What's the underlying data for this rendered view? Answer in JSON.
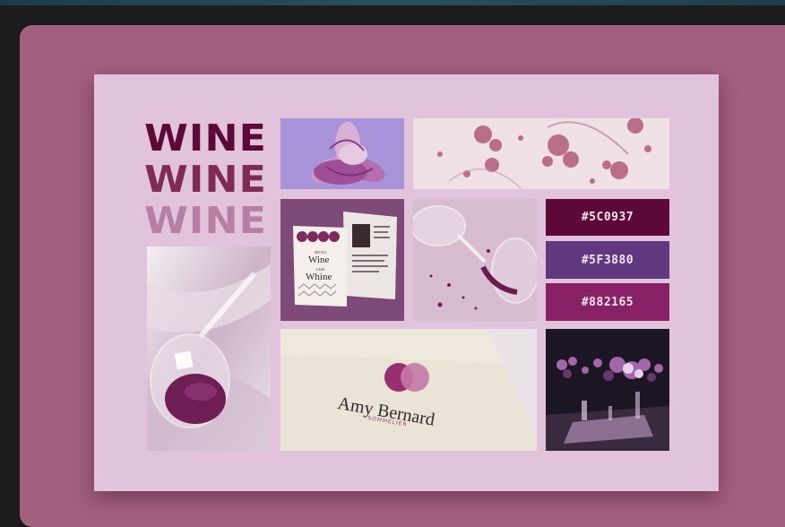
{
  "wordmark": [
    "WINE",
    "WINE",
    "WINE"
  ],
  "palette": [
    {
      "label": "#5C0937",
      "color": "#5c0937"
    },
    {
      "label": "#5F3880",
      "color": "#5f3880"
    },
    {
      "label": "#882165",
      "color": "#882165"
    }
  ],
  "menu_card": {
    "small": "MENU",
    "line1": "Wine",
    "connector": "LESS",
    "line2": "Whine"
  },
  "business_card": {
    "name": "Amy Bernard",
    "title": "SOMMELIER"
  },
  "colors": {
    "stage": "#a2607f",
    "board": "#e1c4dc"
  },
  "icons": [
    "orchid-photo",
    "wine-splatter-photo",
    "menu-mockup-photo",
    "spilled-wine-glass-photo",
    "poured-wine-glass-photo",
    "business-card-photo",
    "flower-table-photo"
  ]
}
